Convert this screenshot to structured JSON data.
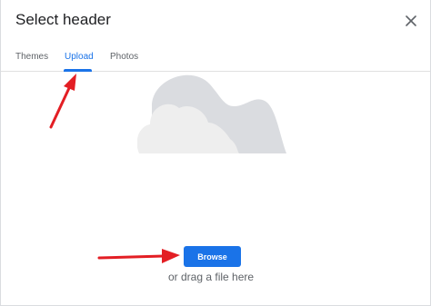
{
  "dialog": {
    "title": "Select header",
    "close_icon": "close-icon"
  },
  "tabs": [
    {
      "label": "Themes",
      "active": false
    },
    {
      "label": "Upload",
      "active": true
    },
    {
      "label": "Photos",
      "active": false
    }
  ],
  "upload": {
    "illustration_icon": "cloud-icon",
    "browse_label": "Browse",
    "drag_hint": "or drag a file here"
  },
  "colors": {
    "accent": "#1a73e8",
    "arrow": "#e31e24",
    "cloud_back": "#dadce0",
    "cloud_front": "#eeeeee"
  }
}
